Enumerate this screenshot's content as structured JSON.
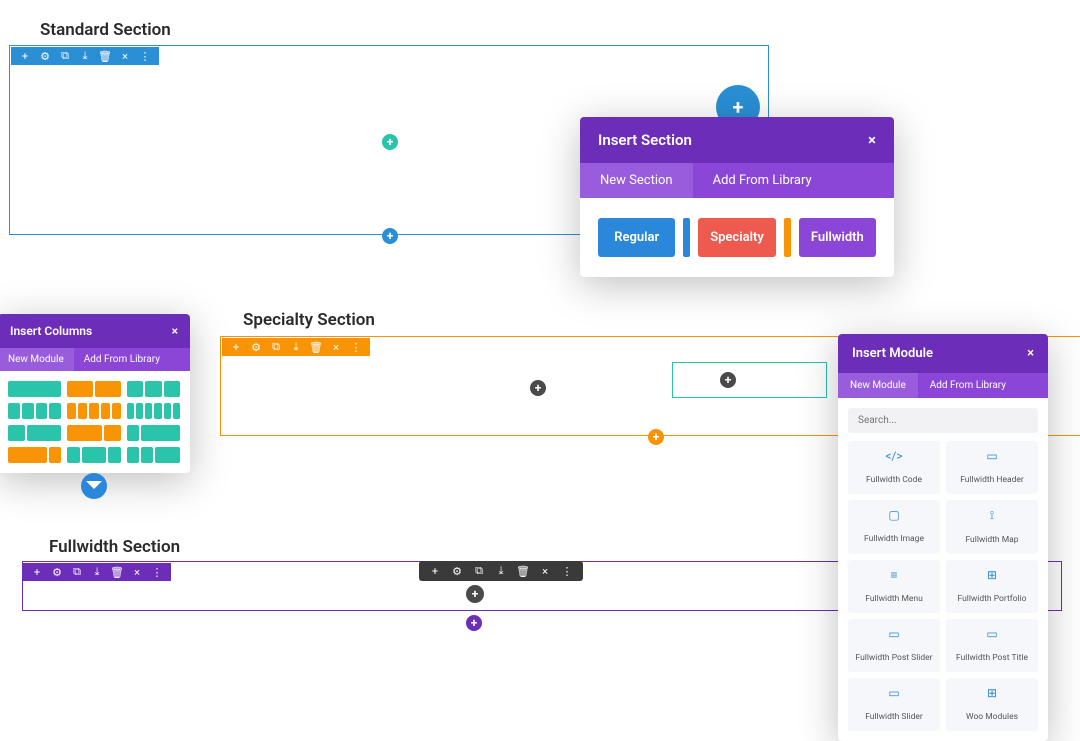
{
  "titles": {
    "standard": "Standard Section",
    "specialty": "Specialty Section",
    "fullwidth": "Fullwidth Section"
  },
  "insert_section": {
    "title": "Insert Section",
    "tabs": {
      "new": "New Section",
      "library": "Add From Library"
    },
    "buttons": {
      "regular": "Regular",
      "specialty": "Specialty",
      "fullwidth": "Fullwidth"
    }
  },
  "insert_columns": {
    "title": "Insert Columns",
    "tabs": {
      "new": "New Module",
      "library": "Add From Library"
    }
  },
  "insert_module": {
    "title": "Insert Module",
    "tabs": {
      "new": "New Module",
      "library": "Add From Library"
    },
    "search_placeholder": "Search...",
    "items": [
      "Fullwidth Code",
      "Fullwidth Header",
      "Fullwidth Image",
      "Fullwidth Map",
      "Fullwidth Menu",
      "Fullwidth Portfolio",
      "Fullwidth Post Slider",
      "Fullwidth Post Title",
      "Fullwidth Slider",
      "Woo Modules"
    ]
  },
  "icons": {
    "plus": "+",
    "close": "×"
  }
}
